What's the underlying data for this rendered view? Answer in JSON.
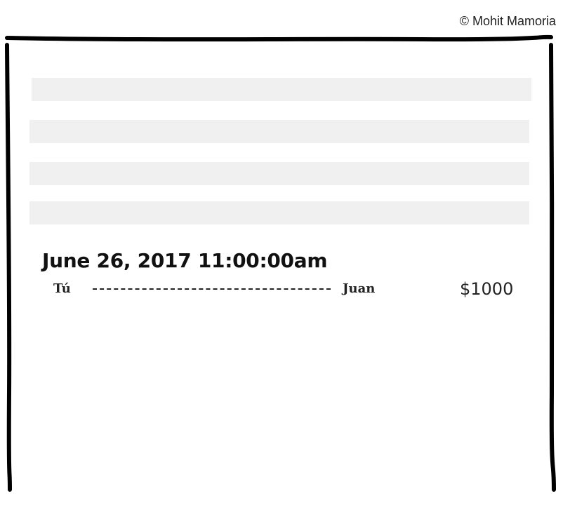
{
  "footer": {
    "copyright": "© Mohit Mamoria"
  },
  "placeholders": {
    "count": 4
  },
  "transaction": {
    "datetime": "June 26, 2017 11:00:00am",
    "from": "Tú",
    "to": "Juan",
    "amount": "$1000"
  },
  "colors": {
    "placeholder_bar": "#f0f0f0",
    "ink": "#111111"
  }
}
